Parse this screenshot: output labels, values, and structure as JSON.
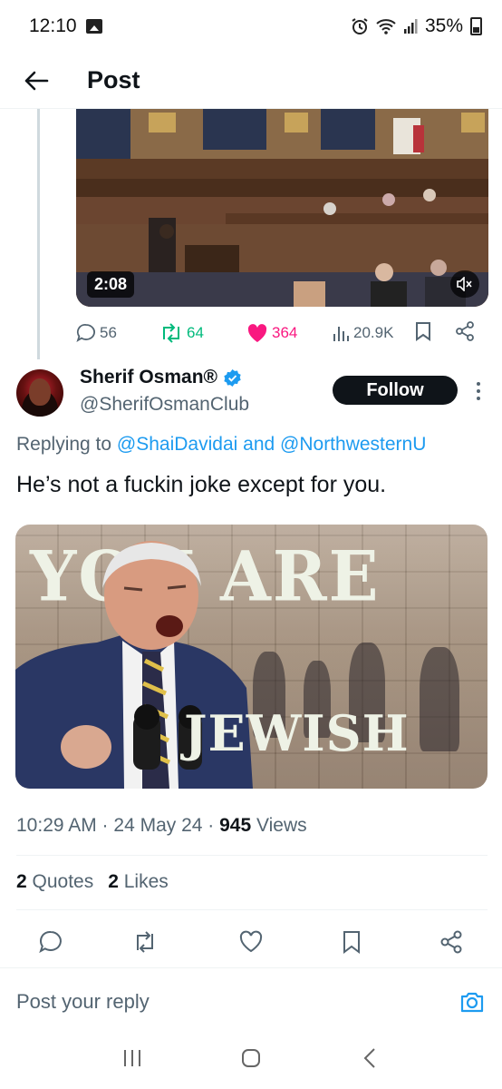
{
  "status_bar": {
    "time": "12:10",
    "battery": "35%",
    "icons": [
      "gallery-icon",
      "alarm-icon",
      "wifi-icon",
      "signal-icon",
      "battery-icon"
    ]
  },
  "header": {
    "title": "Post",
    "back_icon": "arrow-left-icon"
  },
  "parent_post": {
    "video_duration": "2:08",
    "replies": "56",
    "reposts": "64",
    "likes": "364",
    "views": "20.9K",
    "colors": {
      "repost": "#00ba7c",
      "like": "#f91880",
      "muted": "#536471"
    }
  },
  "reply_post": {
    "author_name": "Sherif Osman®",
    "author_handle": "@SherifOsmanClub",
    "follow_label": "Follow",
    "replying_prefix": "Replying to",
    "replying_mention_1": "@ShaiDavidai",
    "replying_and": "and",
    "replying_mention_2": "@NorthwesternU",
    "text": "He’s not a fuckin joke except for you.",
    "image_text_top": "YOU ARE",
    "image_text_bottom": "JEWISH",
    "timestamp": "10:29 AM · 24 May 24 · ",
    "views_count": "945",
    "views_label": " Views",
    "quotes_count": "2",
    "quotes_label": " Quotes",
    "likes_count": "2",
    "likes_label": " Likes",
    "colors": {
      "link": "#1d9bf0",
      "verified": "#1d9bf0",
      "text": "#0f1419"
    }
  },
  "reply_composer": {
    "placeholder": "Post your reply"
  },
  "system_nav": {
    "items": [
      "recent-apps-icon",
      "home-icon",
      "back-icon"
    ]
  }
}
